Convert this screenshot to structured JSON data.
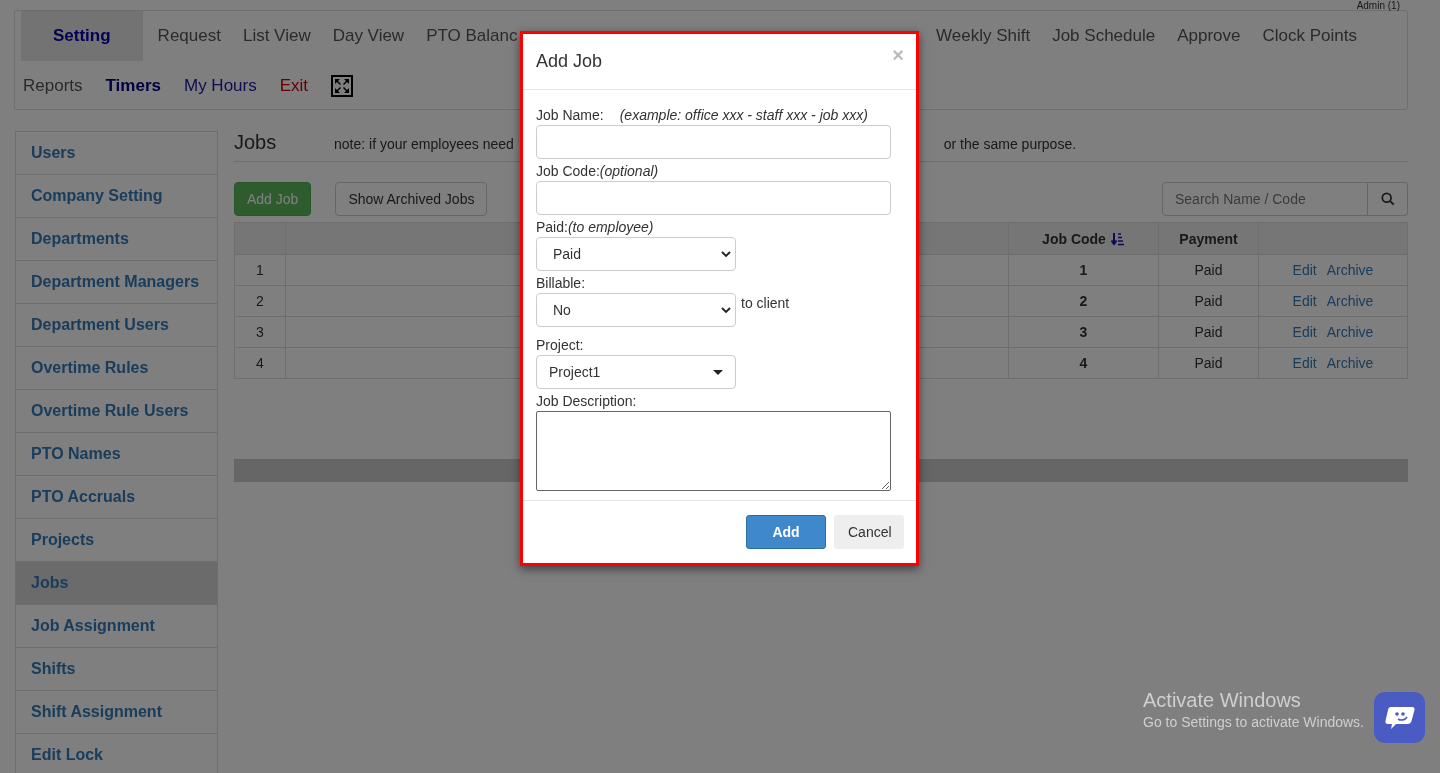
{
  "header": {
    "user": "Admin (1)"
  },
  "nav": {
    "row1_left": [
      {
        "label": "Setting",
        "selected": true
      },
      {
        "label": "Request",
        "selected": false
      },
      {
        "label": "List View",
        "selected": false
      },
      {
        "label": "Day View",
        "selected": false
      },
      {
        "label": "PTO Balanc",
        "selected": false
      }
    ],
    "row1_right": [
      {
        "label": "Weekly Shift",
        "selected": false
      },
      {
        "label": "Job Schedule",
        "selected": false
      },
      {
        "label": "Approve",
        "selected": false
      },
      {
        "label": "Clock Points",
        "selected": false
      }
    ],
    "row2": [
      {
        "label": "Reports",
        "selected": false,
        "kind": "plain"
      },
      {
        "label": "Timers",
        "selected": false,
        "kind": "bold"
      },
      {
        "label": "My Hours",
        "selected": false,
        "kind": "link"
      },
      {
        "label": "Exit",
        "selected": false,
        "kind": "danger"
      }
    ]
  },
  "sidebar": {
    "items": [
      {
        "label": "Users",
        "selected": false
      },
      {
        "label": "Company Setting",
        "selected": false
      },
      {
        "label": "Departments",
        "selected": false
      },
      {
        "label": "Department Managers",
        "selected": false
      },
      {
        "label": "Department Users",
        "selected": false
      },
      {
        "label": "Overtime Rules",
        "selected": false
      },
      {
        "label": "Overtime Rule Users",
        "selected": false
      },
      {
        "label": "PTO Names",
        "selected": false
      },
      {
        "label": "PTO Accruals",
        "selected": false
      },
      {
        "label": "Projects",
        "selected": false
      },
      {
        "label": "Jobs",
        "selected": true
      },
      {
        "label": "Job Assignment",
        "selected": false
      },
      {
        "label": "Shifts",
        "selected": false
      },
      {
        "label": "Shift Assignment",
        "selected": false
      },
      {
        "label": "Edit Lock",
        "selected": false
      }
    ]
  },
  "main": {
    "title": "Jobs",
    "note_start": "note: if your employees need",
    "note_end": "or the same purpose.",
    "buttons": [
      {
        "label": "Add Job",
        "kind": "primary"
      },
      {
        "label": "Show Archived Jobs",
        "kind": "default"
      }
    ],
    "search": {
      "placeholder": "Search Name / Code"
    },
    "table": {
      "columns": [
        "Job Code",
        "Payment"
      ],
      "rows": [
        {
          "number": "1",
          "job_code": "1",
          "payment": "Paid",
          "actions": [
            "Edit",
            "Archive"
          ]
        },
        {
          "number": "2",
          "job_code": "2",
          "payment": "Paid",
          "actions": [
            "Edit",
            "Archive"
          ]
        },
        {
          "number": "3",
          "job_code": "3",
          "payment": "Paid",
          "actions": [
            "Edit",
            "Archive"
          ]
        },
        {
          "number": "4",
          "job_code": "4",
          "payment": "Paid",
          "actions": [
            "Edit",
            "Archive"
          ]
        }
      ]
    }
  },
  "modal": {
    "title": "Add Job",
    "close": "×",
    "fields": [
      {
        "kind": "text",
        "label": "Job Name:",
        "hint": "(example: office xxx - staff xxx - job xxx)"
      },
      {
        "kind": "text",
        "label": "Job Code:",
        "hint": "(optional)"
      },
      {
        "kind": "select",
        "label": "Paid:",
        "hint": "(to employee)",
        "value": "Paid"
      },
      {
        "kind": "select",
        "label": "Billable:",
        "value": "No",
        "suffix": "to client"
      },
      {
        "kind": "dropdown",
        "label": "Project:",
        "value": "Project1"
      },
      {
        "kind": "textarea",
        "label": "Job Description:"
      }
    ],
    "buttons": [
      {
        "label": "Add",
        "kind": "primary"
      },
      {
        "label": "Cancel",
        "kind": "default"
      }
    ]
  },
  "os_notice": {
    "title": "Activate Windows",
    "text": "Go to Settings to activate Windows."
  }
}
